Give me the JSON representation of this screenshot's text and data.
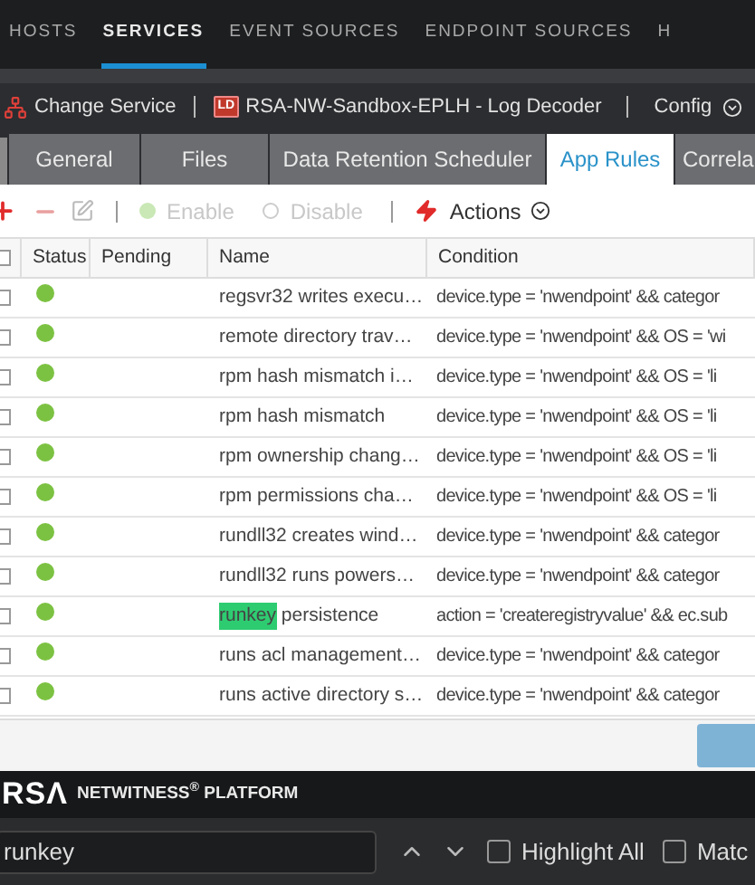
{
  "nav": [
    {
      "label": "HOSTS",
      "selected": false
    },
    {
      "label": "SERVICES",
      "selected": true
    },
    {
      "label": "EVENT SOURCES",
      "selected": false
    },
    {
      "label": "ENDPOINT SOURCES",
      "selected": false
    },
    {
      "label": "H",
      "selected": false
    }
  ],
  "service_bar": {
    "change": "Change Service",
    "badge": "LD",
    "service": "RSA-NW-Sandbox-EPLH - Log Decoder",
    "menu": "Config"
  },
  "tabs": [
    {
      "label": "General",
      "selected": false
    },
    {
      "label": "Files",
      "selected": false
    },
    {
      "label": "Data Retention Scheduler",
      "selected": false
    },
    {
      "label": "App Rules",
      "selected": true
    },
    {
      "label": "Correla",
      "selected": false
    }
  ],
  "toolbar": {
    "enable": {
      "label": "Enable",
      "disabled": true
    },
    "disable": {
      "label": "Disable",
      "disabled": true
    },
    "actions": "Actions"
  },
  "table": {
    "select_all_checked": false,
    "columns": [
      "Status",
      "Pending",
      "Name",
      "Condition"
    ],
    "rows": [
      {
        "checked": false,
        "enabled": true,
        "name": "regsvr32 writes execu…",
        "condition": "device.type = 'nwendpoint' && categor"
      },
      {
        "checked": false,
        "enabled": true,
        "name": "remote directory trav…",
        "condition": "device.type = 'nwendpoint' && OS = 'wi"
      },
      {
        "checked": false,
        "enabled": true,
        "name": "rpm hash mismatch i…",
        "condition": "device.type = 'nwendpoint' && OS = 'li"
      },
      {
        "checked": false,
        "enabled": true,
        "name": "rpm hash mismatch",
        "condition": "device.type = 'nwendpoint' && OS = 'li"
      },
      {
        "checked": false,
        "enabled": true,
        "name": "rpm ownership chang…",
        "condition": "device.type = 'nwendpoint' && OS = 'li"
      },
      {
        "checked": false,
        "enabled": true,
        "name": "rpm permissions cha…",
        "condition": "device.type = 'nwendpoint' && OS = 'li"
      },
      {
        "checked": false,
        "enabled": true,
        "name": "rundll32 creates wind…",
        "condition": "device.type = 'nwendpoint' && categor"
      },
      {
        "checked": false,
        "enabled": true,
        "name": "rundll32 runs powers…",
        "condition": "device.type = 'nwendpoint' && categor"
      },
      {
        "checked": false,
        "enabled": true,
        "match": "runkey",
        "name": " persistence",
        "condition": "action = 'createregistryvalue' && ec.sub"
      },
      {
        "checked": false,
        "enabled": true,
        "name": "runs acl management…",
        "condition": "device.type = 'nwendpoint' && categor"
      },
      {
        "checked": false,
        "enabled": true,
        "name": "runs active directory s…",
        "condition": "device.type = 'nwendpoint' && categor"
      }
    ]
  },
  "footer_logo": {
    "mark": "RSΛ",
    "product": "NETWITNESS$^{®}$ PLATFORM"
  },
  "find_bar": {
    "value": "runkey",
    "options": [
      {
        "label": "Highlight All",
        "checked": false
      },
      {
        "label": "Matc",
        "checked": false
      }
    ]
  }
}
